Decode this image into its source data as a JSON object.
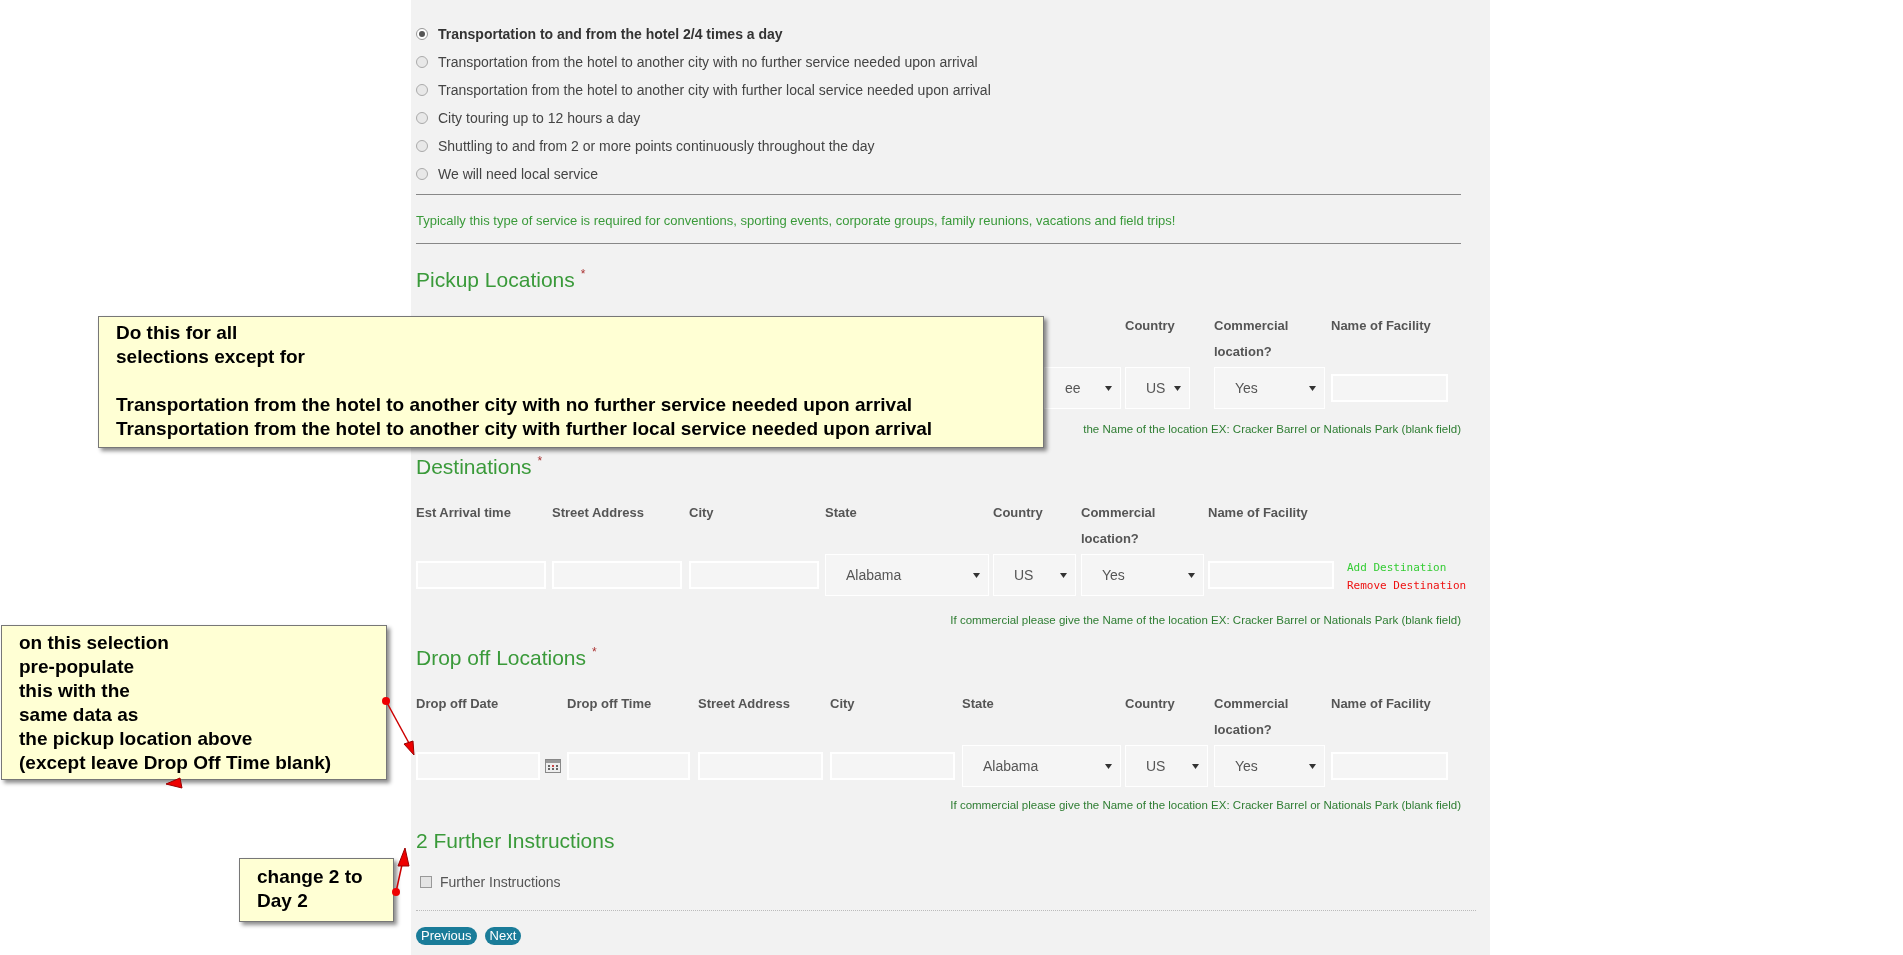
{
  "service_options": [
    {
      "label": "Transportation to and from the hotel 2/4 times a day",
      "selected": true
    },
    {
      "label": "Transportation from the hotel to another city with no further service needed upon arrival",
      "selected": false
    },
    {
      "label": "Transportation from the hotel to another city with further local service needed upon arrival",
      "selected": false
    },
    {
      "label": "City touring up to 12 hours a day",
      "selected": false
    },
    {
      "label": "Shuttling to and from 2 or more points continuously throughout the day",
      "selected": false
    },
    {
      "label": "We will need local service",
      "selected": false
    }
  ],
  "service_note": "Typically this type of service is required for conventions, sporting events, corporate groups, family reunions, vacations and field trips!",
  "sections": [
    {
      "title": "Pickup Locations",
      "required_mark": "*",
      "columns": [
        {
          "field": {
            "kind": "select",
            "value": "ee"
          }
        },
        {
          "label": "Country",
          "field": {
            "kind": "select",
            "value": "US"
          }
        },
        {
          "label": "Commercial location?",
          "field": {
            "kind": "select",
            "value": "Yes"
          }
        },
        {
          "label": "Name of Facility",
          "field": {
            "kind": "input"
          }
        }
      ],
      "hint": "the Name of the location EX: Cracker Barrel or Nationals Park (blank field)"
    },
    {
      "title": "Destinations",
      "required_mark": "*",
      "columns": [
        {
          "label": "Est Arrival time",
          "field": {
            "kind": "input"
          }
        },
        {
          "label": "Street Address",
          "field": {
            "kind": "input"
          }
        },
        {
          "label": "City",
          "field": {
            "kind": "input"
          }
        },
        {
          "label": "State",
          "field": {
            "kind": "select",
            "value": "Alabama"
          }
        },
        {
          "label": "Country",
          "field": {
            "kind": "select",
            "value": "US"
          }
        },
        {
          "label": "Commercial location?",
          "field": {
            "kind": "select",
            "value": "Yes"
          }
        },
        {
          "label": "Name of Facility",
          "field": {
            "kind": "input"
          }
        }
      ],
      "links": [
        {
          "label": "Add Destination",
          "kind": "add"
        },
        {
          "label": "Remove Destination",
          "kind": "remove"
        }
      ],
      "hint": "If commercial please give the Name of the location EX: Cracker Barrel or Nationals Park (blank field)"
    },
    {
      "title": "Drop off Locations",
      "required_mark": "*",
      "columns": [
        {
          "label": "Drop off Date",
          "field": {
            "kind": "date"
          }
        },
        {
          "label": "Drop off Time",
          "field": {
            "kind": "input"
          }
        },
        {
          "label": "Street Address",
          "field": {
            "kind": "input"
          }
        },
        {
          "label": "City",
          "field": {
            "kind": "input"
          }
        },
        {
          "label": "State",
          "field": {
            "kind": "select",
            "value": "Alabama"
          }
        },
        {
          "label": "Country",
          "field": {
            "kind": "select",
            "value": "US"
          }
        },
        {
          "label": "Commercial location?",
          "field": {
            "kind": "select",
            "value": "Yes"
          }
        },
        {
          "label": "Name of Facility",
          "field": {
            "kind": "input"
          }
        }
      ],
      "hint": "If commercial please give the Name of the location EX: Cracker Barrel or Nationals Park (blank field)"
    }
  ],
  "further": {
    "title": "2 Further Instructions",
    "checkbox": {
      "label": "Further Instructions",
      "checked": false
    }
  },
  "buttons": [
    "Previous",
    "Next"
  ],
  "callouts": [
    {
      "text": "Do this for all\nselections except for\n\nTransportation from the hotel to another city with no further service needed upon arrival\nTransportation from the hotel to another city with further local service needed upon arrival"
    },
    {
      "text": "on this selection\npre-populate\nthis with the\nsame data as\nthe pickup location above\n(except leave Drop Off Time blank)"
    },
    {
      "text": "change 2 to\nDay 2"
    }
  ]
}
